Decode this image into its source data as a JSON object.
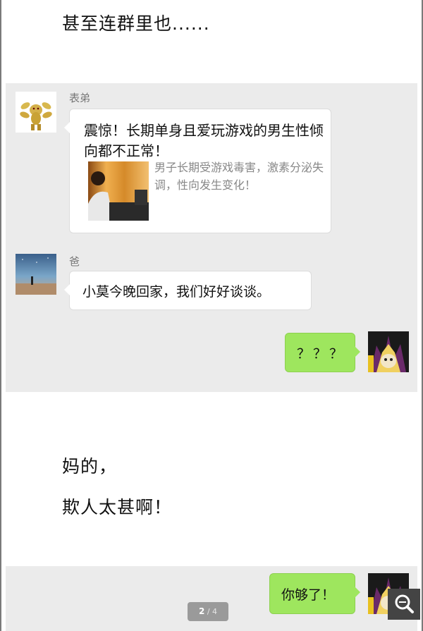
{
  "captions": {
    "top": "甚至连群里也......",
    "bottom_line1": "妈的，",
    "bottom_line2": "欺人太甚啊！"
  },
  "chat1": {
    "messages": [
      {
        "sender": "表弟",
        "type": "link",
        "title": "震惊！长期单身且爱玩游戏的男生性倾向都不正常！",
        "description": "男子长期受游戏毒害，激素分泌失调，性向发生变化！"
      },
      {
        "sender": "爸",
        "type": "text",
        "text": "小莫今晚回家，我们好好谈谈。"
      },
      {
        "sender": "",
        "type": "self-text",
        "text": "？？？"
      }
    ]
  },
  "chat2": {
    "self_message": "你够了！"
  },
  "viewer": {
    "page_current": "2",
    "page_separator": " / ",
    "page_total": "4",
    "zoom_icon": "magnifier-icon"
  },
  "colors": {
    "chat_bg": "#ebebeb",
    "self_bubble": "#9ee65e",
    "other_bubble": "#ffffff"
  }
}
